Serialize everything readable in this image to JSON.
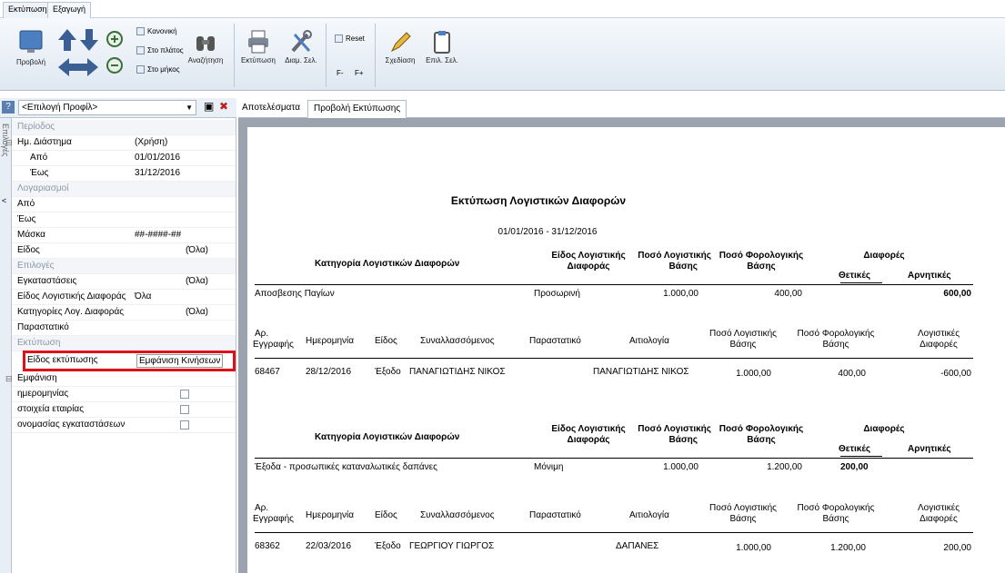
{
  "ribbon": {
    "tabs": [
      "Εκτύπωση",
      "Εξαγωγή"
    ],
    "preview_label": "Προβολή",
    "zoom_options": [
      "Κανονική",
      "Στο πλάτος",
      "Στο μήκος"
    ],
    "search_label": "Αναζήτηση",
    "print_label": "Εκτύπωση",
    "page_setup_label": "Διαμ. Σελ.",
    "reset_label": "Reset",
    "font_minus": "F-",
    "font_plus": "F+",
    "design_label": "Σχεδίαση",
    "select_page_label": "Επιλ. Σελ."
  },
  "left": {
    "profile_select": "<Επιλογή Προφίλ>",
    "vertical_tab": "Επιλογές",
    "rows": [
      {
        "k": "Περίοδος",
        "v": "",
        "type": "cat"
      },
      {
        "k": "Ημ. Διάστημα",
        "v": "(Χρήση)",
        "type": "group"
      },
      {
        "k": "Από",
        "v": "01/01/2016",
        "type": "sub"
      },
      {
        "k": "Έως",
        "v": "31/12/2016",
        "type": "sub"
      },
      {
        "k": "Λογαριασμοί",
        "v": "",
        "type": "cat"
      },
      {
        "k": "Από",
        "v": "",
        "type": ""
      },
      {
        "k": "Έως",
        "v": "",
        "type": ""
      },
      {
        "k": "Μάσκα",
        "v": "##-####-##",
        "type": ""
      },
      {
        "k": "Είδος",
        "v": "(Όλα)",
        "type": "rv"
      },
      {
        "k": "Επιλογές",
        "v": "",
        "type": "cat"
      },
      {
        "k": "Εγκαταστάσεις",
        "v": "(Όλα)",
        "type": "rv"
      },
      {
        "k": "Είδος Λογιστικής Διαφοράς",
        "v": "Όλα",
        "type": ""
      },
      {
        "k": "Κατηγορίες Λογ. Διαφοράς",
        "v": "(Όλα)",
        "type": "rv"
      },
      {
        "k": "Παραστατικό",
        "v": "",
        "type": ""
      },
      {
        "k": "Εκτύπωση",
        "v": "",
        "type": "cat"
      },
      {
        "k": "Είδος εκτύπωσης",
        "v": "Εμφάνιση Κινήσεων",
        "type": "hl"
      },
      {
        "k": "Εμφάνιση",
        "v": "",
        "type": "group"
      },
      {
        "k": "ημερομηνίας",
        "v": "",
        "type": "check"
      },
      {
        "k": "στοιχεία εταιρίας",
        "v": "",
        "type": "check"
      },
      {
        "k": "ονομασίας εγκαταστάσεων",
        "v": "",
        "type": "check"
      }
    ]
  },
  "tabs": [
    "Αποτελέσματα",
    "Προβολή Εκτύπωσης"
  ],
  "report": {
    "title": "Εκτύπωση Λογιστικών Διαφορών",
    "period": "01/01/2016 - 31/12/2016",
    "head": {
      "category": "Κατηγορία Λογιστικών Διαφορών",
      "kind_1": "Είδος Λογιστικής",
      "kind_2": "Διαφοράς",
      "acc_1": "Ποσό Λογιστικής",
      "acc_2": "Βάσης",
      "tax_1": "Ποσό Φορολογικής",
      "tax_2": "Βάσης",
      "diff": "Διαφορές",
      "pos": "Θετικές",
      "neg": "Αρνητικές"
    },
    "detail_head": {
      "no_1": "Αρ.",
      "no_2": "Εγγραφής",
      "date": "Ημερομηνία",
      "kind": "Είδος",
      "partner": "Συναλλασσόμενος",
      "doc": "Παραστατικό",
      "reason": "Αιτιολογία",
      "acc_1": "Ποσό Λογιστικής",
      "acc_2": "Βάσης",
      "tax_1": "Ποσό Φορολογικής",
      "tax_2": "Βάσης",
      "ld_1": "Λογιστικές",
      "ld_2": "Διαφορές"
    },
    "g1": {
      "cat": "Αποσβεσης Παγίων",
      "kind": "Προσωρινή",
      "acc": "1.000,00",
      "tax": "400,00",
      "neg": "600,00"
    },
    "d1": {
      "no": "68467",
      "date": "28/12/2016",
      "kind": "Έξοδο",
      "partner": "ΠΑΝΑΓΙΩΤΙΔΗΣ ΝΙΚΟΣ",
      "reason": "ΠΑΝΑΓΙΩΤΙΔΗΣ ΝΙΚΟΣ",
      "acc": "1.000,00",
      "tax": "400,00",
      "diff": "-600,00"
    },
    "g2": {
      "cat": "Έξοδα - προσωπικές καταναλωτικές δαπάνες",
      "kind": "Μόνιμη",
      "acc": "1.000,00",
      "tax": "1.200,00",
      "pos": "200,00"
    },
    "d2": {
      "no": "68362",
      "date": "22/03/2016",
      "kind": "Έξοδο",
      "partner": "ΓΕΩΡΓΙΟΥ ΓΙΩΡΓΟΣ",
      "reason": "ΔΑΠΑΝΕΣ",
      "acc": "1.000,00",
      "tax": "1.200,00",
      "diff": "200,00"
    }
  }
}
